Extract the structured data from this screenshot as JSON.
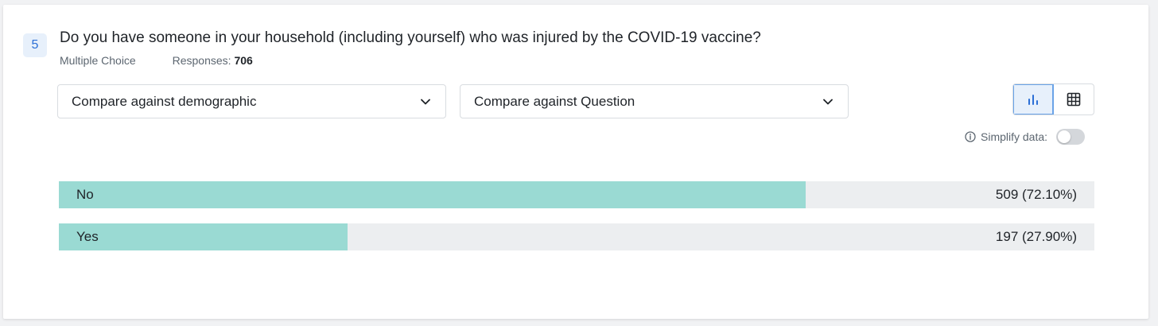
{
  "question": {
    "number": "5",
    "title": "Do you have someone in your household (including yourself) who was injured by the COVID-19 vaccine?",
    "type": "Multiple Choice",
    "responses_label": "Responses:",
    "responses_count": "706"
  },
  "filters": {
    "demographic": "Compare against demographic",
    "question": "Compare against Question"
  },
  "view": {
    "active": "chart",
    "options": [
      "chart-icon",
      "table-icon"
    ]
  },
  "simplify": {
    "label": "Simplify data:",
    "enabled": false
  },
  "colors": {
    "bar_fill": "#9adad3",
    "bar_track": "#eceef0",
    "accent": "#2b6fd6"
  },
  "chart_data": {
    "type": "bar",
    "categories": [
      "No",
      "Yes"
    ],
    "values": [
      509,
      197
    ],
    "percents": [
      72.1,
      27.9
    ],
    "value_labels": [
      "509 (72.10%)",
      "197 (27.90%)"
    ]
  }
}
